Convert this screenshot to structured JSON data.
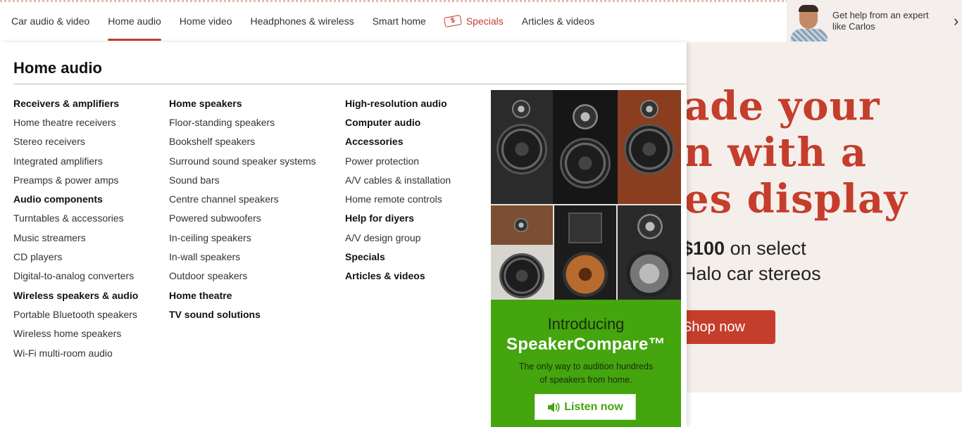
{
  "nav": {
    "items": [
      {
        "label": "Car audio & video"
      },
      {
        "label": "Home audio"
      },
      {
        "label": "Home video"
      },
      {
        "label": "Headphones & wireless"
      },
      {
        "label": "Smart home"
      },
      {
        "label": "Specials"
      },
      {
        "label": "Articles & videos"
      }
    ],
    "active": "Home audio",
    "specials_color": "#c53d2b"
  },
  "expert": {
    "line1": "Get help from an expert",
    "line2": "like Carlos"
  },
  "menu": {
    "title": "Home audio",
    "col1": [
      {
        "label": "Receivers & amplifiers",
        "heading": true
      },
      {
        "label": "Home theatre receivers"
      },
      {
        "label": "Stereo receivers"
      },
      {
        "label": "Integrated amplifiers"
      },
      {
        "label": "Preamps & power amps"
      },
      {
        "label": "Audio components",
        "heading": true
      },
      {
        "label": "Turntables & accessories"
      },
      {
        "label": "Music streamers"
      },
      {
        "label": "CD players"
      },
      {
        "label": "Digital-to-analog converters"
      },
      {
        "label": "Wireless speakers & audio",
        "heading": true
      },
      {
        "label": "Portable Bluetooth speakers"
      },
      {
        "label": "Wireless home speakers"
      },
      {
        "label": "Wi-Fi multi-room audio"
      }
    ],
    "col2": [
      {
        "label": "Home speakers",
        "heading": true
      },
      {
        "label": "Floor-standing speakers"
      },
      {
        "label": "Bookshelf speakers"
      },
      {
        "label": "Surround sound speaker systems"
      },
      {
        "label": "Sound bars"
      },
      {
        "label": "Centre channel speakers"
      },
      {
        "label": "Powered subwoofers"
      },
      {
        "label": "In-ceiling speakers"
      },
      {
        "label": "In-wall speakers"
      },
      {
        "label": "Outdoor speakers"
      },
      {
        "label": "Home theatre",
        "heading": true
      },
      {
        "label": "TV sound solutions",
        "heading": true
      }
    ],
    "col3": [
      {
        "label": "High-resolution audio",
        "heading": true
      },
      {
        "label": "Computer audio",
        "heading": true
      },
      {
        "label": "Accessories",
        "heading": true
      },
      {
        "label": "Power protection"
      },
      {
        "label": "A/V cables & installation"
      },
      {
        "label": "Home remote controls"
      },
      {
        "label": "Help for diyers",
        "heading": true
      },
      {
        "label": "A/V design group"
      },
      {
        "label": "Specials",
        "heading": true
      },
      {
        "label": "Articles & videos",
        "heading": true
      }
    ]
  },
  "ad": {
    "intro": "Introducing",
    "brand": "SpeakerCompare™",
    "desc1": "The only way to audition hundreds",
    "desc2": "of speakers from home.",
    "button": "Listen now",
    "green": "#44a50e"
  },
  "banner": {
    "line1": "ade your",
    "line2": "n with a",
    "line3": "es display",
    "sub1_bold": "$100",
    "sub1_rest": " on select",
    "sub2": "Halo car stereos",
    "button": "Shop now",
    "accent": "#c53d2b"
  }
}
